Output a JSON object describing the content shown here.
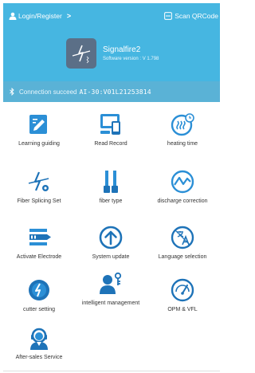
{
  "header": {
    "login_label": "Login/Register",
    "login_chevron": ">",
    "scan_label": "Scan QRCode",
    "device_name": "Signalfire2",
    "software_version": "Software version : V 1.798",
    "connection_status": "Connection succeed",
    "serial_number": "AI-30:V01L21253814"
  },
  "colors": {
    "header_bg": "#46b6e1",
    "status_bg": "#5ab2d6",
    "icon_blue": "#2b8fd6",
    "icon_dark": "#1e73b8"
  },
  "menu": [
    {
      "label": "Learning guiding",
      "icon": "learning-guiding-icon"
    },
    {
      "label": "Read Record",
      "icon": "read-record-icon"
    },
    {
      "label": "heating time",
      "icon": "heating-time-icon"
    },
    {
      "label": "Fiber Splicing Set",
      "icon": "fiber-splicing-set-icon"
    },
    {
      "label": "fiber type",
      "icon": "fiber-type-icon"
    },
    {
      "label": "discharge correction",
      "icon": "discharge-correction-icon"
    },
    {
      "label": "Activate Electrode",
      "icon": "activate-electrode-icon"
    },
    {
      "label": "System update",
      "icon": "system-update-icon"
    },
    {
      "label": "Language selection",
      "icon": "language-selection-icon"
    },
    {
      "label": "cutter setting",
      "icon": "cutter-setting-icon"
    },
    {
      "label": "intelligent management",
      "icon": "intelligent-management-icon"
    },
    {
      "label": "OPM & VFL",
      "icon": "opm-vfl-icon"
    },
    {
      "label": "After-sales Service",
      "icon": "after-sales-service-icon"
    }
  ]
}
